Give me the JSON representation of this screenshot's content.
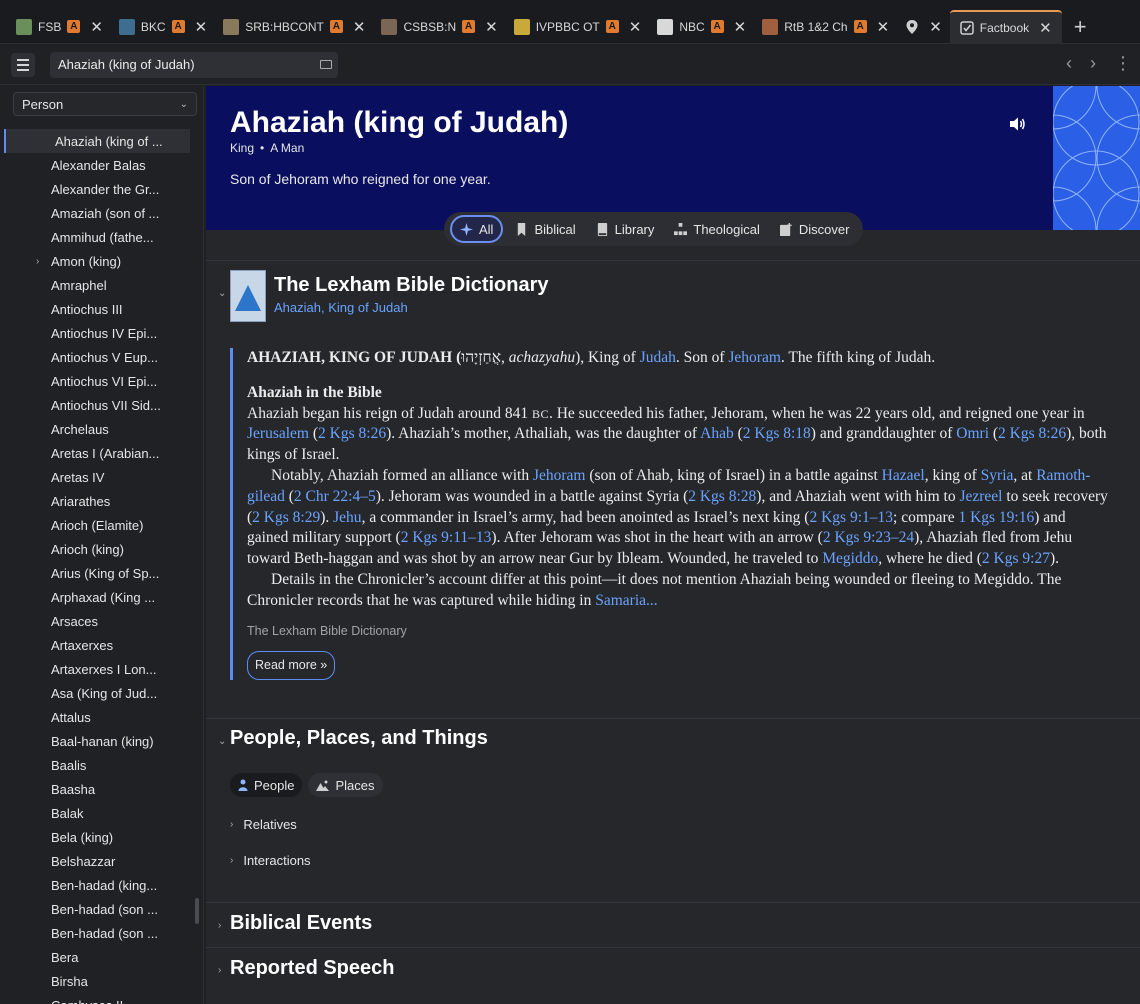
{
  "tabs": [
    {
      "label": "FSB",
      "icon_color": "#6b8f5a",
      "badge": "A"
    },
    {
      "label": "BKC",
      "icon_color": "#3d6e8f",
      "badge": "A"
    },
    {
      "label": "SRB:HBCONT",
      "icon_color": "#8a7a5c",
      "badge": "A"
    },
    {
      "label": "CSBSB:N",
      "icon_color": "#7a6655",
      "badge": "A"
    },
    {
      "label": "IVPBBC OT",
      "icon_color": "#c9a93a",
      "badge": "A"
    },
    {
      "label": "NBC",
      "icon_color": "#d8d8d8",
      "badge": "A"
    },
    {
      "label": "RtB 1&2 Ch",
      "icon_color": "#a06040",
      "badge": "A"
    },
    {
      "label": "",
      "icon_color": "#cfcfcf",
      "badge": ""
    },
    {
      "label": "Factbook",
      "icon_color": "#cfcfcf",
      "badge": ""
    }
  ],
  "toolbar": {
    "search_value": "Ahaziah (king of Judah)"
  },
  "sidebar": {
    "type_select": "Person",
    "items": [
      "Ahaziah (king of ...",
      "Alexander Balas",
      "Alexander the Gr...",
      "Amaziah (son of ...",
      "Ammihud (fathe...",
      "Amon (king)",
      "Amraphel",
      "Antiochus III",
      "Antiochus IV Epi...",
      "Antiochus V Eup...",
      "Antiochus VI Epi...",
      "Antiochus VII Sid...",
      "Archelaus",
      "Aretas I (Arabian...",
      "Aretas IV",
      "Ariarathes",
      "Arioch (Elamite)",
      "Arioch (king)",
      "Arius (King of Sp...",
      "Arphaxad (King ...",
      "Arsaces",
      "Artaxerxes",
      "Artaxerxes I Lon...",
      "Asa (King of Jud...",
      "Attalus",
      "Baal-hanan (king)",
      "Baalis",
      "Baasha",
      "Balak",
      "Bela (king)",
      "Belshazzar",
      "Ben-hadad (king...",
      "Ben-hadad (son ...",
      "Ben-hadad (son ...",
      "Bera",
      "Birsha",
      "Cambyses II"
    ]
  },
  "hero": {
    "title": "Ahaziah (king of Judah)",
    "role": "King",
    "sep": "•",
    "gender": "A Man",
    "description": "Son of Jehoram who reigned for one year.",
    "accent": "#0a0e5e"
  },
  "filters": [
    "All",
    "Biblical",
    "Library",
    "Theological",
    "Discover"
  ],
  "dictionary": {
    "title": "The Lexham Bible Dictionary",
    "subtitle": "Ahaziah, King of Judah",
    "intro_head": "AHAZIAH, KING OF JUDAH (",
    "intro_hebrew": "אֲחַזְיָהוּ",
    "intro_comma": ", ",
    "intro_translit": "achazyahu",
    "intro_mid": "), King of ",
    "intro_judah": "Judah",
    "intro_son": ". Son of ",
    "intro_jehoram": "Jehoram",
    "intro_end": ". The fifth king of Judah.",
    "section_heading": "Ahaziah in the Bible",
    "p1_a": "Ahaziah began his reign of Judah around 841 ",
    "p1_bc": "BC",
    "p1_b": ". He succeeded his father, Jehoram, when he was 22 years old, and reigned one year in ",
    "p1_jerusalem": "Jerusalem",
    "p1_c": " (",
    "p1_ref1": "2 Kgs 8:26",
    "p1_d": "). Ahaziah’s mother, Athaliah, was the daughter of ",
    "p1_ahab": "Ahab",
    "p1_e": " (",
    "p1_ref2": "2 Kgs 8:18",
    "p1_f": ") and granddaughter of ",
    "p1_omri": "Omri",
    "p1_g": " (",
    "p1_ref3": "2 Kgs 8:26",
    "p1_h": "), both kings of Israel.",
    "p2_a": "Notably, Ahaziah formed an alliance with ",
    "p2_jehoram": "Jehoram",
    "p2_b": " (son of Ahab, king of Israel) in a battle against ",
    "p2_hazael": "Hazael",
    "p2_c": ", king of ",
    "p2_syria": "Syria",
    "p2_d": ", at ",
    "p2_ramoth": "Ramoth-gilead",
    "p2_e": " (",
    "p2_ref1": "2 Chr 22:4–5",
    "p2_f": "). Jehoram was wounded in a battle against Syria (",
    "p2_ref2": "2 Kgs 8:28",
    "p2_g": "), and Ahaziah went with him to ",
    "p2_jezreel": "Jezreel",
    "p2_h": " to seek recovery (",
    "p2_ref3": "2 Kgs 8:29",
    "p2_i": "). ",
    "p2_jehu": "Jehu",
    "p2_j": ", a commander in Israel’s army, had been anointed as Israel’s next king (",
    "p2_ref4": "2 Kgs 9:1–13",
    "p2_k": "; compare ",
    "p2_ref5": "1 Kgs 19:16",
    "p2_l": ") and gained military support (",
    "p2_ref6": "2 Kgs 9:11–13",
    "p2_m": "). After Jehoram was shot in the heart with an arrow (",
    "p2_ref7": "2 Kgs 9:23–24",
    "p2_n": "), Ahaziah fled from Jehu toward Beth-haggan and was shot by an arrow near Gur by Ibleam. Wounded, he traveled to ",
    "p2_megiddo": "Megiddo",
    "p2_o": ", where he died (",
    "p2_ref8": "2 Kgs 9:27",
    "p2_p": ").",
    "p3_a": "Details in the Chronicler’s account differ at this point—it does not mention Ahaziah being wounded or fleeing to Megiddo. The Chronicler records that he was captured while hiding in ",
    "p3_samaria": "Samaria...",
    "source": "The Lexham Bible Dictionary",
    "read_more": "Read more »"
  },
  "ppt": {
    "title": "People, Places, and Things",
    "chip_people": "People",
    "chip_places": "Places",
    "relatives": "Relatives",
    "interactions": "Interactions"
  },
  "sections": {
    "biblical_events": "Biblical Events",
    "reported_speech": "Reported Speech"
  }
}
